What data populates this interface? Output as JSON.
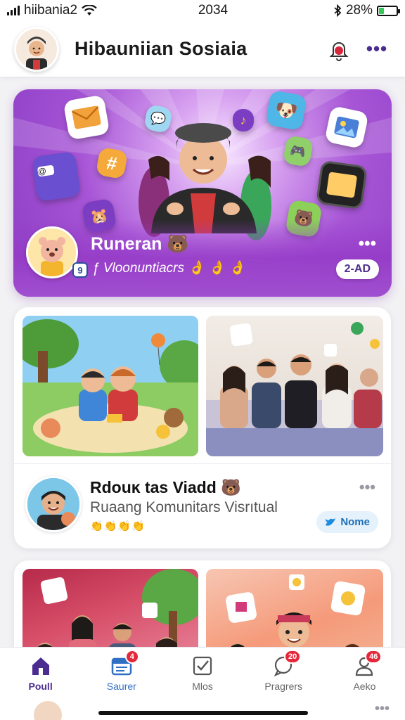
{
  "status_bar": {
    "carrier": "hiibania2",
    "time": "2034",
    "battery_text": "28%",
    "battery_level": 0.28
  },
  "header": {
    "title": "Hibauniian Sosiaia",
    "more_label": "•••"
  },
  "featured": {
    "name": "Runeran 🐻",
    "subtitle": "ƒ Vloonuntiacrs 👌 👌 👌",
    "more_label": "•••",
    "badge": "2-AD",
    "avatar_badge": "9"
  },
  "post": {
    "title": "Rdouĸ tas Viadd 🐻",
    "subtitle": "Ruaang Komunitars Visrıtual",
    "reactions": "👏👏👏👏",
    "more_label": "•••",
    "share_label": "Nome"
  },
  "nav": {
    "items": [
      {
        "label": "Poull",
        "icon": "home-icon",
        "badge": ""
      },
      {
        "label": "Saurer",
        "icon": "inbox-icon",
        "badge": "4"
      },
      {
        "label": "Mlos",
        "icon": "check-box-icon",
        "badge": ""
      },
      {
        "label": "Pragrers",
        "icon": "chat-icon",
        "badge": "20"
      },
      {
        "label": "Aeko",
        "icon": "profile-icon",
        "badge": "46"
      }
    ]
  },
  "peek": {
    "more_label": "•••"
  },
  "colors": {
    "accent": "#4b2d8f",
    "feature_purple": "#a755d6",
    "badge_red": "#e5273a"
  }
}
